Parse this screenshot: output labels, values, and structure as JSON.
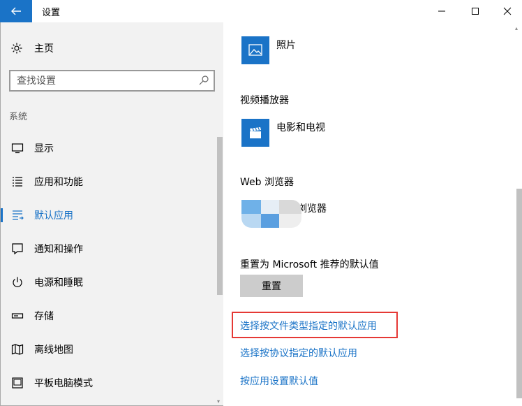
{
  "window": {
    "title": "设置"
  },
  "sidebar": {
    "home_label": "主页",
    "search_placeholder": "查找设置",
    "section_label": "系统",
    "items": [
      {
        "label": "显示",
        "icon": "display-icon",
        "active": false
      },
      {
        "label": "应用和功能",
        "icon": "apps-list-icon",
        "active": false
      },
      {
        "label": "默认应用",
        "icon": "default-apps-icon",
        "active": true
      },
      {
        "label": "通知和操作",
        "icon": "notification-icon",
        "active": false
      },
      {
        "label": "电源和睡眠",
        "icon": "power-icon",
        "active": false
      },
      {
        "label": "存储",
        "icon": "storage-icon",
        "active": false
      },
      {
        "label": "离线地图",
        "icon": "map-icon",
        "active": false
      },
      {
        "label": "平板电脑模式",
        "icon": "tablet-icon",
        "active": false
      }
    ]
  },
  "main": {
    "photo_app": "照片",
    "video_category": "视频播放器",
    "video_app": "电影和电视",
    "browser_category": "Web 浏览器",
    "browser_app": "浏览器",
    "reset_label": "重置为 Microsoft 推荐的默认值",
    "reset_button": "重置",
    "links": [
      "选择按文件类型指定的默认应用",
      "选择按协议指定的默认应用",
      "按应用设置默认值"
    ]
  },
  "colors": {
    "accent": "#1a73c7",
    "highlight": "#e53935",
    "sidebar_bg": "#f2f2f2"
  }
}
